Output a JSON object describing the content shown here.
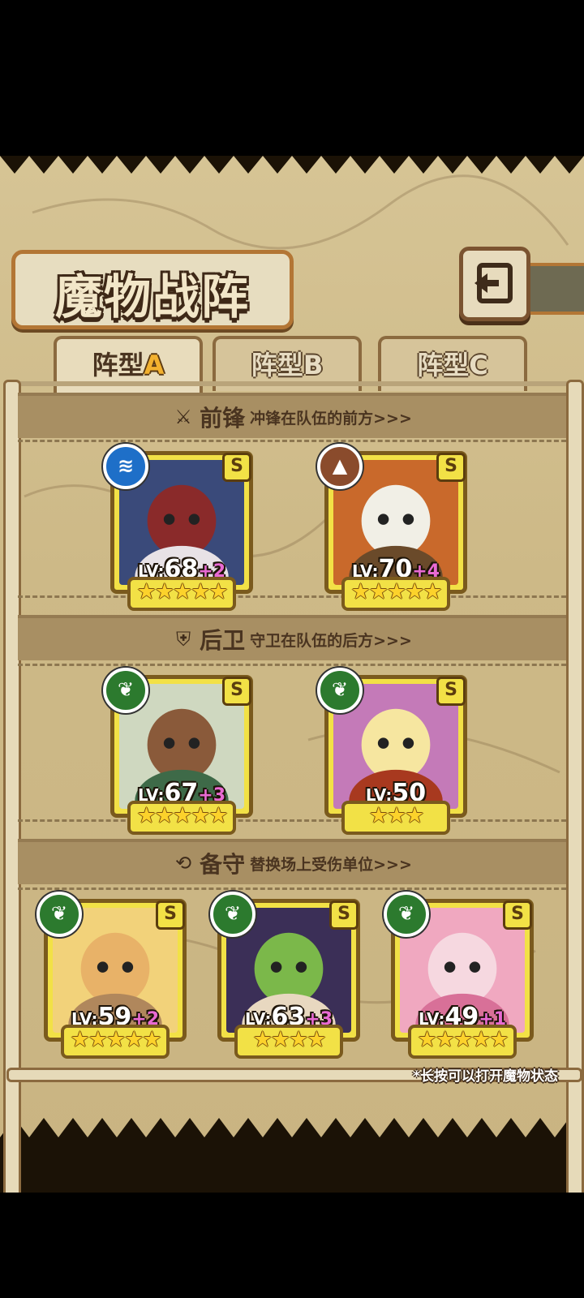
{
  "header": {
    "title": "魔物战阵",
    "back_icon": "return-arrow-icon"
  },
  "tabs": [
    {
      "prefix": "阵型",
      "letter": "A",
      "active": true
    },
    {
      "prefix": "阵型",
      "letter": "B",
      "active": false
    },
    {
      "prefix": "阵型",
      "letter": "C",
      "active": false
    }
  ],
  "sections": {
    "front": {
      "title": "前锋",
      "desc": "冲锋在队伍的前方>>>",
      "icon": "sword-icon"
    },
    "rear": {
      "title": "后卫",
      "desc": "守卫在队伍的后方>>>",
      "icon": "shield-icon"
    },
    "reserve": {
      "title": "备守",
      "desc": "替换场上受伤单位>>>",
      "icon": "swap-icon"
    }
  },
  "units": {
    "front": [
      {
        "element": "water-icon",
        "rank": "S",
        "lv_label": "LV:",
        "level": "68",
        "plus": "+2",
        "stars": 5
      },
      {
        "element": "earth-icon",
        "rank": "S",
        "lv_label": "LV:",
        "level": "70",
        "plus": "+4",
        "stars": 5
      }
    ],
    "rear": [
      {
        "element": "leaf-icon",
        "rank": "S",
        "lv_label": "LV:",
        "level": "67",
        "plus": "+3",
        "stars": 5
      },
      {
        "element": "leaf-icon",
        "rank": "S",
        "lv_label": "LV:",
        "level": "50",
        "plus": "",
        "stars": 3
      }
    ],
    "reserve": [
      {
        "element": "leaf-icon",
        "rank": "S",
        "lv_label": "LV:",
        "level": "59",
        "plus": "+2",
        "stars": 5
      },
      {
        "element": "leaf-icon",
        "rank": "S",
        "lv_label": "LV:",
        "level": "63",
        "plus": "+3",
        "stars": 4
      },
      {
        "element": "leaf-icon",
        "rank": "S",
        "lv_label": "LV:",
        "level": "49",
        "plus": "+1",
        "stars": 5
      }
    ]
  },
  "hint": "*长按可以打开魔物状态",
  "colors": {
    "card_frame": "#f2e146",
    "panel": "#d6c495",
    "accent": "#f2b12f",
    "plus": "#e86ad3"
  }
}
